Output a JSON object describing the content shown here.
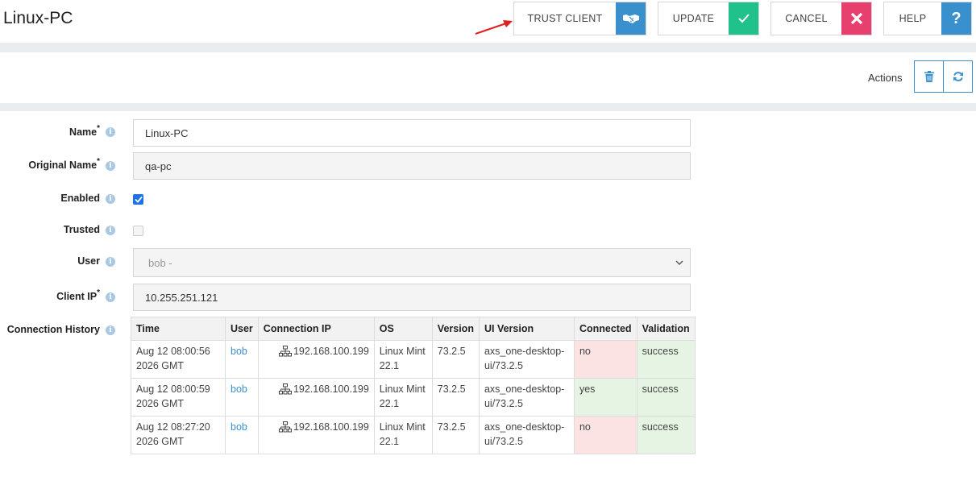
{
  "header": {
    "title": "Linux-PC",
    "buttons": {
      "trust": "TRUST CLIENT",
      "update": "UPDATE",
      "cancel": "CANCEL",
      "help": "HELP",
      "help_icon": "?"
    }
  },
  "colors": {
    "trust_icon_bg": "#3a8fcd",
    "update_icon_bg": "#20c18a",
    "cancel_icon_bg": "#e8406e",
    "help_icon_bg": "#3a8fcd",
    "arrow": "#e02020",
    "band": "#e9edf0"
  },
  "icons": {
    "trust": "handshake-icon",
    "update": "check-icon",
    "cancel": "x-icon",
    "help": "question-icon",
    "delete": "trash-icon",
    "refresh": "refresh-icon",
    "info": "info-icon",
    "network": "network-icon"
  },
  "actions": {
    "label": "Actions"
  },
  "form": {
    "name": {
      "label": "Name",
      "required": "*",
      "value": "Linux-PC"
    },
    "original_name": {
      "label": "Original Name",
      "required": "*",
      "value": "qa-pc"
    },
    "enabled": {
      "label": "Enabled",
      "checked": true
    },
    "trusted": {
      "label": "Trusted",
      "checked": false
    },
    "user": {
      "label": "User",
      "value": "bob -"
    },
    "client_ip": {
      "label": "Client IP",
      "required": "*",
      "value": "10.255.251.121"
    },
    "connection_history": {
      "label": "Connection History"
    }
  },
  "history": {
    "columns": [
      "Time",
      "User",
      "Connection IP",
      "OS",
      "Version",
      "UI Version",
      "Connected",
      "Validation"
    ],
    "rows": [
      {
        "time": "Aug 12 08:00:56 2026 GMT",
        "user": "bob",
        "ip": "192.168.100.199",
        "os": "Linux Mint 22.1",
        "version": "73.2.5",
        "ui_version": "axs_one-desktop-ui/73.2.5",
        "connected": "no",
        "validation": "success"
      },
      {
        "time": "Aug 12 08:00:59 2026 GMT",
        "user": "bob",
        "ip": "192.168.100.199",
        "os": "Linux Mint 22.1",
        "version": "73.2.5",
        "ui_version": "axs_one-desktop-ui/73.2.5",
        "connected": "yes",
        "validation": "success"
      },
      {
        "time": "Aug 12 08:27:20 2026 GMT",
        "user": "bob",
        "ip": "192.168.100.199",
        "os": "Linux Mint 22.1",
        "version": "73.2.5",
        "ui_version": "axs_one-desktop-ui/73.2.5",
        "connected": "no",
        "validation": "success"
      }
    ]
  }
}
